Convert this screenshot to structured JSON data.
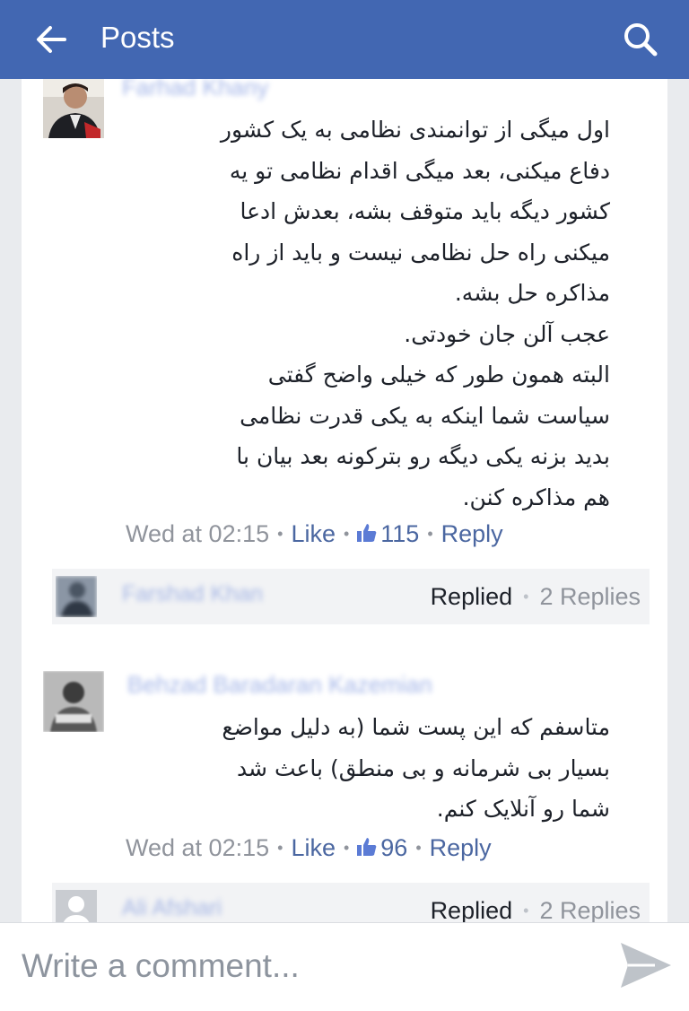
{
  "header": {
    "title": "Posts",
    "back_icon": "arrow-left-icon",
    "search_icon": "search-icon",
    "background": "#4267b2"
  },
  "comments": [
    {
      "author": "Farhad Khany",
      "text": "اول میگی از توانمندی نظامی به یک کشور\nدفاع میکنی، بعد میگی اقدام نظامی تو یه\nکشور دیگه باید متوقف بشه، بعدش ادعا\nمیکنی راه حل نظامی نیست و باید از راه\nمذاکره حل بشه.\nعجب آلن جان خودتی.\nالبته همون طور که خیلی واضح گفتی\nسیاست شما اینکه به یکی قدرت نظامی\nبدید بزنه یکی دیگه رو بترکونه بعد بیان با\nهم مذاکره کنن.",
      "time": "Wed at 02:15",
      "like_label": "Like",
      "like_count": "115",
      "reply_label": "Reply",
      "reply_summary": {
        "author": "Farshad Khan",
        "status": "Replied",
        "count": "2 Replies"
      }
    },
    {
      "author": "Behzad Baradaran Kazemian",
      "text": "متاسفم که این پست شما (به دلیل مواضع\nبسیار بی شرمانه و بی منطق) باعث شد\nشما رو آنلایک کنم.",
      "time": "Wed at 02:15",
      "like_label": "Like",
      "like_count": "96",
      "reply_label": "Reply",
      "reply_summary": {
        "author": "Ali Afshari",
        "status": "Replied",
        "count": "2 Replies"
      }
    }
  ],
  "composer": {
    "placeholder": "Write a comment...",
    "send_icon": "send-icon"
  },
  "colors": {
    "link": "#4b67a1",
    "meta": "#90949c",
    "text": "#1d2129"
  }
}
